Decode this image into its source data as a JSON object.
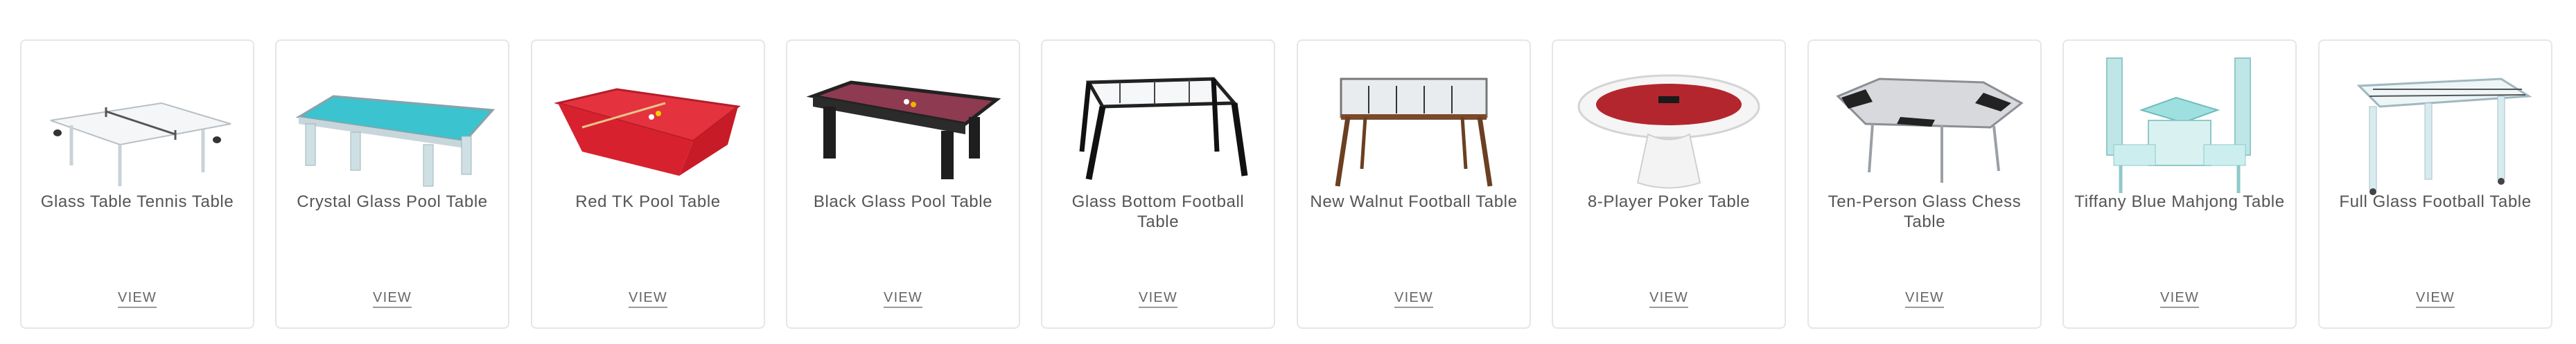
{
  "products": [
    {
      "title": "Glass Table Tennis Table",
      "view_label": "VIEW",
      "image": "glass-table-tennis-table-image"
    },
    {
      "title": "Crystal Glass Pool Table",
      "view_label": "VIEW",
      "image": "crystal-glass-pool-table-image"
    },
    {
      "title": "Red TK Pool Table",
      "view_label": "VIEW",
      "image": "red-tk-pool-table-image"
    },
    {
      "title": "Black Glass Pool Table",
      "view_label": "VIEW",
      "image": "black-glass-pool-table-image"
    },
    {
      "title": "Glass Bottom Football Table",
      "view_label": "VIEW",
      "image": "glass-bottom-football-table-image"
    },
    {
      "title": "New Walnut Football Table",
      "view_label": "VIEW",
      "image": "new-walnut-football-table-image"
    },
    {
      "title": "8-Player Poker Table",
      "view_label": "VIEW",
      "image": "8-player-poker-table-image"
    },
    {
      "title": "Ten-Person Glass Chess Table",
      "view_label": "VIEW",
      "image": "ten-person-glass-chess-table-image"
    },
    {
      "title": "Tiffany Blue Mahjong Table",
      "view_label": "VIEW",
      "image": "tiffany-blue-mahjong-table-image"
    },
    {
      "title": "Full Glass Football Table",
      "view_label": "VIEW",
      "image": "full-glass-football-table-image"
    }
  ]
}
